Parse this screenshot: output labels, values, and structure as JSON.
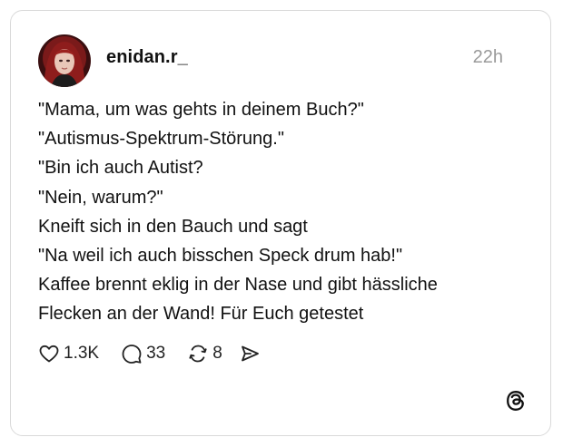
{
  "post": {
    "username": "enidan.r_",
    "timestamp": "22h",
    "lines": [
      "\"Mama, um was gehts in deinem Buch?\"",
      "\"Autismus-Spektrum-Störung.\"",
      "\"Bin ich auch Autist?",
      "\"Nein, warum?\"",
      "Kneift sich in den Bauch und sagt",
      "\"Na weil ich auch bisschen Speck drum hab!\"",
      "Kaffee brennt eklig in der Nase und gibt hässliche",
      "Flecken an der Wand! Für Euch getestet"
    ]
  },
  "actions": {
    "likes": "1.3K",
    "comments": "33",
    "reposts": "8"
  },
  "icons": {
    "like": "heart-icon",
    "comment": "comment-bubble-icon",
    "repost": "repost-icon",
    "share": "send-icon",
    "brand": "threads-logo-icon"
  },
  "colors": {
    "text": "#111111",
    "muted": "#9a9a9a",
    "border": "#d9d9d9"
  }
}
